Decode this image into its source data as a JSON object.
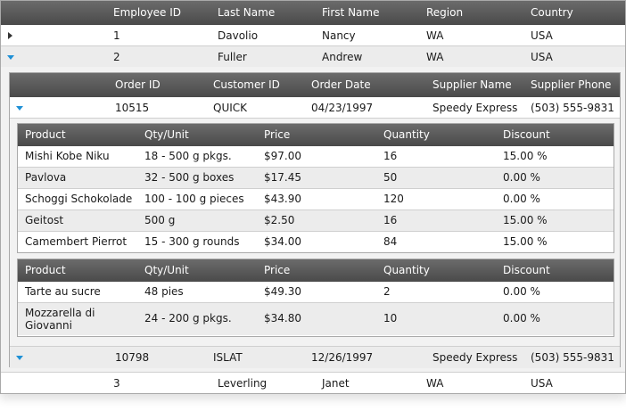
{
  "employees": {
    "columns": [
      "Employee ID",
      "Last Name",
      "First Name",
      "Region",
      "Country"
    ],
    "rows": [
      {
        "id": "1",
        "last": "Davolio",
        "first": "Nancy",
        "region": "WA",
        "country": "USA"
      },
      {
        "id": "2",
        "last": "Fuller",
        "first": "Andrew",
        "region": "WA",
        "country": "USA"
      },
      {
        "id": "3",
        "last": "Leverling",
        "first": "Janet",
        "region": "WA",
        "country": "USA"
      }
    ]
  },
  "orders": {
    "columns": [
      "Order ID",
      "Customer ID",
      "Order Date",
      "Supplier Name",
      "Supplier Phone"
    ],
    "rows": [
      {
        "id": "10515",
        "customer": "QUICK",
        "date": "04/23/1997",
        "supplier": "Speedy Express",
        "phone": "(503) 555-9831"
      },
      {
        "id": "10798",
        "customer": "ISLAT",
        "date": "12/26/1997",
        "supplier": "Speedy Express",
        "phone": "(503) 555-9831"
      }
    ]
  },
  "products": {
    "columns": [
      "Product",
      "Qty/Unit",
      "Price",
      "Quantity",
      "Discount"
    ],
    "table1": [
      {
        "product": "Mishi Kobe Niku",
        "qty": "18 - 500 g pkgs.",
        "price": "$97.00",
        "quantity": "16",
        "discount": "15.00 %"
      },
      {
        "product": "Pavlova",
        "qty": "32 - 500 g boxes",
        "price": "$17.45",
        "quantity": "50",
        "discount": "0.00 %"
      },
      {
        "product": "Schoggi Schokolade",
        "qty": "100 - 100 g pieces",
        "price": "$43.90",
        "quantity": "120",
        "discount": "0.00 %"
      },
      {
        "product": "Geitost",
        "qty": "500 g",
        "price": "$2.50",
        "quantity": "16",
        "discount": "15.00 %"
      },
      {
        "product": "Camembert Pierrot",
        "qty": "15 - 300 g rounds",
        "price": "$34.00",
        "quantity": "84",
        "discount": "15.00 %"
      }
    ],
    "table2": [
      {
        "product": "Tarte au sucre",
        "qty": "48 pies",
        "price": "$49.30",
        "quantity": "2",
        "discount": "0.00 %"
      },
      {
        "product_line1": "Mozzarella di",
        "product_line2": "Giovanni",
        "qty": "24 - 200 g pkgs.",
        "price": "$34.80",
        "quantity": "10",
        "discount": "0.00 %"
      }
    ]
  },
  "icons": {
    "collapsed": "triangle-right-icon",
    "expanded": "triangle-down-icon"
  },
  "colors": {
    "header": "#4a4a4a",
    "expander": "#1e90d6",
    "alt_row": "#ececec"
  }
}
